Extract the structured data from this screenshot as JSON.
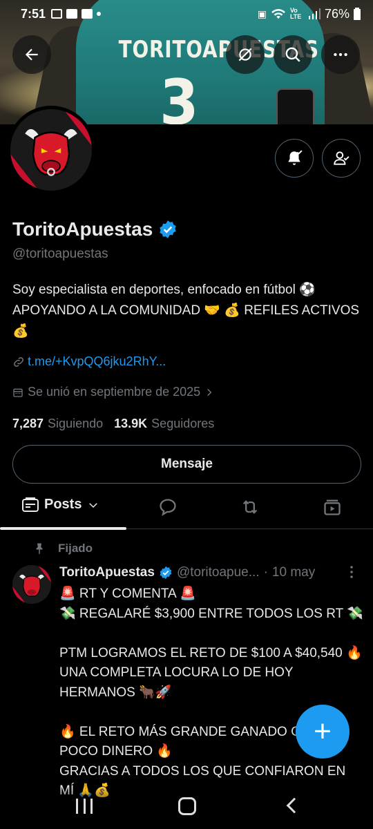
{
  "status_bar": {
    "time": "7:51",
    "battery": "76%",
    "network": "Vo LTE"
  },
  "banner": {
    "jersey_text": "TORITOAPUESTAS",
    "jersey_number": "3"
  },
  "top_nav": {
    "back_icon": "arrow-left-icon",
    "grok_icon": "grok-icon",
    "search_icon": "search-icon",
    "more_icon": "more-icon"
  },
  "profile": {
    "name": "ToritoApuestas",
    "handle": "@toritoapuestas",
    "bio_line1": "Soy especialista en deportes, enfocado en fútbol ⚽",
    "bio_line2": "APOYANDO A LA COMUNIDAD 🤝 💰 REFILES ACTIVOS 💰",
    "link": "t.me/+KvpQQ6jku2RhY...",
    "joined": "Se unió en septiembre de 2025",
    "following_count": "7,287",
    "following_label": "Siguiendo",
    "followers_count": "13.9K",
    "followers_label": "Seguidores",
    "message_button": "Mensaje"
  },
  "tabs": {
    "posts_label": "Posts"
  },
  "post": {
    "pinned_label": "Fijado",
    "author_name": "ToritoApuestas",
    "author_handle": "@toritoapue...",
    "separator": "·",
    "date": "10 may",
    "text": "🚨 RT Y COMENTA 🚨\n💸 REGALARÉ $3,900 ENTRE TODOS LOS RT 💸\n\nPTM LOGRAMOS EL RETO DE $100 A $40,540 🔥\nUNA COMPLETA LOCURA LO DE HOY HERMANOS 🐂🚀\n\n🔥 EL RETO MÁS GRANDE GANADO CON TAN POCO DINERO 🔥\nGRACIAS A TODOS LOS QUE CONFIARON EN MÍ 🙏💰"
  },
  "fab": {
    "label": "+"
  },
  "colors": {
    "accent": "#1d9bf0",
    "background": "#000000",
    "secondary_text": "#71767b",
    "border": "#536471"
  }
}
